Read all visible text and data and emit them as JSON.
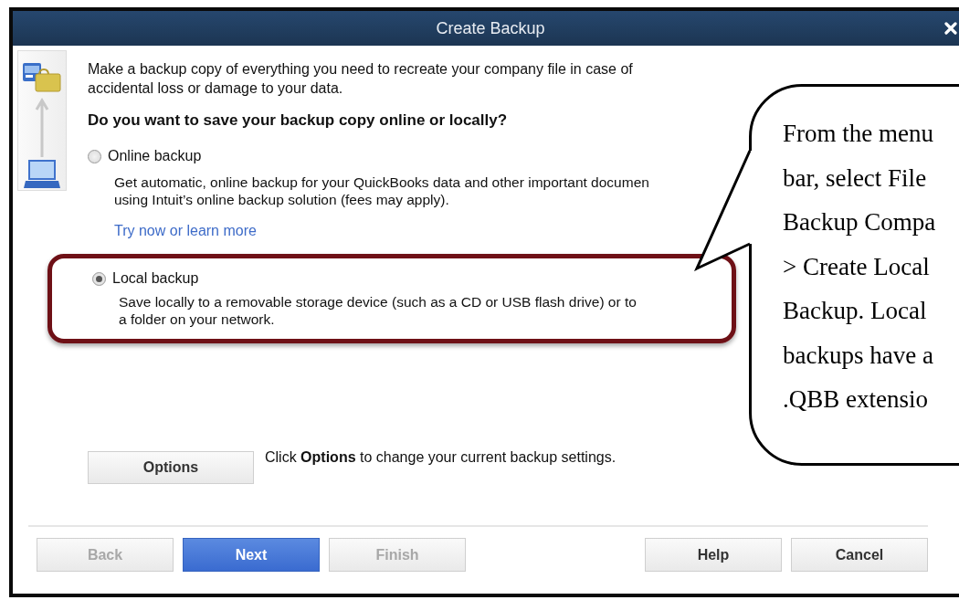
{
  "window": {
    "title": "Create Backup"
  },
  "intro": "Make a backup copy of everything you need to recreate your company file in case of accidental loss or damage to your data.",
  "question": "Do you want to save your backup copy online or locally?",
  "options": [
    {
      "label": "Online backup",
      "selected": false,
      "highlighted": false,
      "description": "Get automatic, online backup for your QuickBooks data and other important documen",
      "second_line": "using Intuit’s online backup solution (fees may apply).",
      "link": "Try now or learn more"
    },
    {
      "label": "Local backup",
      "selected": true,
      "highlighted": true,
      "description": "Save locally to a removable storage device (such as a CD or USB flash drive) or to",
      "second_line": "a folder on your network."
    }
  ],
  "options_button": "Options",
  "options_hint": "Click **Options** to change your current backup settings.",
  "footer_buttons": [
    {
      "label": "Back",
      "kind": "normal",
      "disabled": true
    },
    {
      "label": "Next",
      "kind": "primary",
      "disabled": false
    },
    {
      "label": "Finish",
      "kind": "normal",
      "disabled": true
    },
    {
      "label": "Help",
      "kind": "normal",
      "disabled": false
    },
    {
      "label": "Cancel",
      "kind": "normal",
      "disabled": false
    }
  ],
  "callout": {
    "lines": [
      "From the menu",
      "bar, select File",
      "Backup Compa",
      "> Create Local",
      "Backup. Local",
      "backups have a",
      ".QBB extensio"
    ]
  }
}
